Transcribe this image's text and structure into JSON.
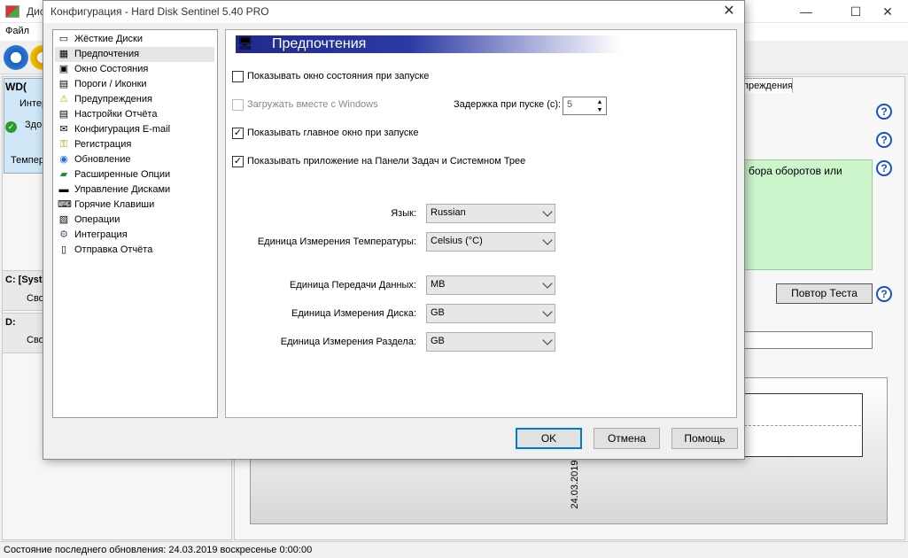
{
  "main_window": {
    "title_partial": "Дис",
    "menu_file": "Файл",
    "tab_partial": "преждения",
    "green_text": "бора оборотов или",
    "repeat_test_button": "Повтор Теста",
    "graph_date": "24.03.2019",
    "left_rows": [
      "WD(",
      "Интер",
      "Здо",
      "Темпер",
      "C: [Syst",
      "Сво",
      "D:",
      "Сво"
    ],
    "status_text": "Состояние последнего обновления: 24.03.2019 воскресенье 0:00:00"
  },
  "dialog": {
    "title": "Конфигурация  -  Hard Disk Sentinel 5.40 PRO",
    "close_glyph": "✕",
    "nav_items": [
      {
        "label": "Жёсткие Диски",
        "icon": "▭"
      },
      {
        "label": "Предпочтения",
        "icon": "▦"
      },
      {
        "label": "Окно Состояния",
        "icon": "▣"
      },
      {
        "label": "Пороги / Иконки",
        "icon": "▤"
      },
      {
        "label": "Предупреждения",
        "icon": "⚠"
      },
      {
        "label": "Настройки Отчёта",
        "icon": "▤"
      },
      {
        "label": "Конфигурация E-mail",
        "icon": "✉"
      },
      {
        "label": "Регистрация",
        "icon": "⚿"
      },
      {
        "label": "Обновление",
        "icon": "◉"
      },
      {
        "label": "Расширенные Опции",
        "icon": "▰"
      },
      {
        "label": "Управление Дисками",
        "icon": "▬"
      },
      {
        "label": "Горячие Клавиши",
        "icon": "⌨"
      },
      {
        "label": "Операции",
        "icon": "▧"
      },
      {
        "label": "Интеграция",
        "icon": "⚙"
      },
      {
        "label": "Отправка Отчёта",
        "icon": "▯"
      }
    ],
    "header": "Предпочтения",
    "options": {
      "show_status_window": {
        "label": "Показывать окно состояния при запуске",
        "checked": false
      },
      "load_with_windows": {
        "label": "Загружать вместе с Windows",
        "checked": false,
        "disabled": true
      },
      "startup_delay_label": "Задержка при пуске (с):",
      "startup_delay_value": "5",
      "show_main_window": {
        "label": "Показывать главное окно при запуске",
        "checked": true
      },
      "show_in_tray": {
        "label": "Показывать приложение на Панели Задач и Системном Трее",
        "checked": true
      }
    },
    "selects": {
      "language": {
        "label": "Язык:",
        "value": "Russian"
      },
      "temp_unit": {
        "label": "Единица Измерения Температуры:",
        "value": "Celsius (°C)"
      },
      "transfer_unit": {
        "label": "Единица Передачи Данных:",
        "value": "MB"
      },
      "disk_unit": {
        "label": "Единица Измерения Диска:",
        "value": "GB"
      },
      "partition_unit": {
        "label": "Единица Измерения Раздела:",
        "value": "GB"
      }
    },
    "buttons": {
      "ok": "OK",
      "cancel": "Отмена",
      "help": "Помощь"
    }
  },
  "colors": {
    "accent": "#1f2a8a",
    "focus": "#0078d7",
    "green_box": "#ccf5cc",
    "help_icon": "#1750c7"
  }
}
